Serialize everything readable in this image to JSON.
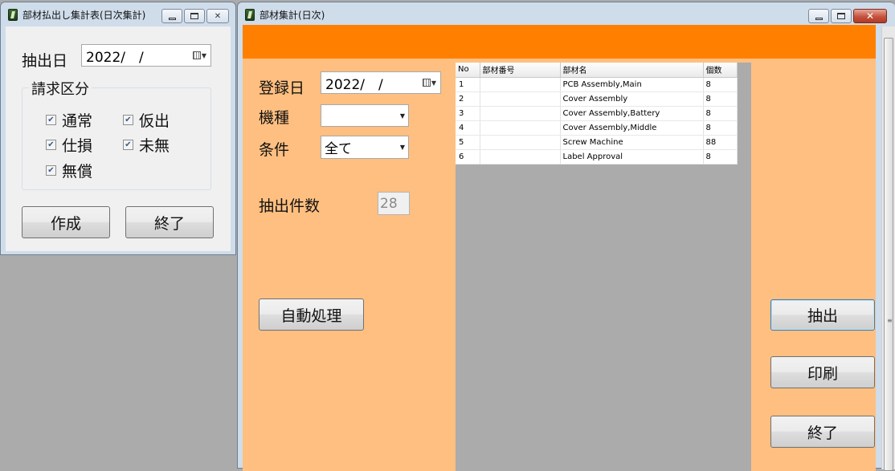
{
  "left_window": {
    "title": "部材払出し集計表(日次集計)",
    "extract_date_label": "抽出日",
    "extract_date_value": "2022/　/",
    "billing_group_label": "請求区分",
    "checkboxes": [
      {
        "label": "通常",
        "checked": true
      },
      {
        "label": "仮出",
        "checked": true
      },
      {
        "label": "仕損",
        "checked": true
      },
      {
        "label": "未無",
        "checked": true
      },
      {
        "label": "無償",
        "checked": true
      }
    ],
    "create_button": "作成",
    "exit_button": "終了",
    "caption_close": "✕"
  },
  "right_window": {
    "title": "部材集計(日次)",
    "reg_date_label": "登録日",
    "reg_date_value": "2022/　/",
    "model_label": "機種",
    "model_value": "",
    "condition_label": "条件",
    "condition_value": "全て",
    "count_label": "抽出件数",
    "count_value": "28",
    "auto_button": "自動処理",
    "extract_button": "抽出",
    "print_button": "印刷",
    "exit_button": "終了",
    "caption_close": "✕",
    "grid": {
      "headers": [
        "No",
        "部材番号",
        "部材名",
        "個数"
      ],
      "rows": [
        [
          "1",
          "",
          "PCB Assembly,Main",
          "8"
        ],
        [
          "2",
          "",
          "Cover Assembly",
          "8"
        ],
        [
          "3",
          "",
          "Cover Assembly,Battery",
          "8"
        ],
        [
          "4",
          "",
          "Cover Assembly,Middle",
          "8"
        ],
        [
          "5",
          "",
          "Screw Machine",
          "88"
        ],
        [
          "6",
          "",
          "Label Approval",
          "8"
        ]
      ]
    }
  }
}
